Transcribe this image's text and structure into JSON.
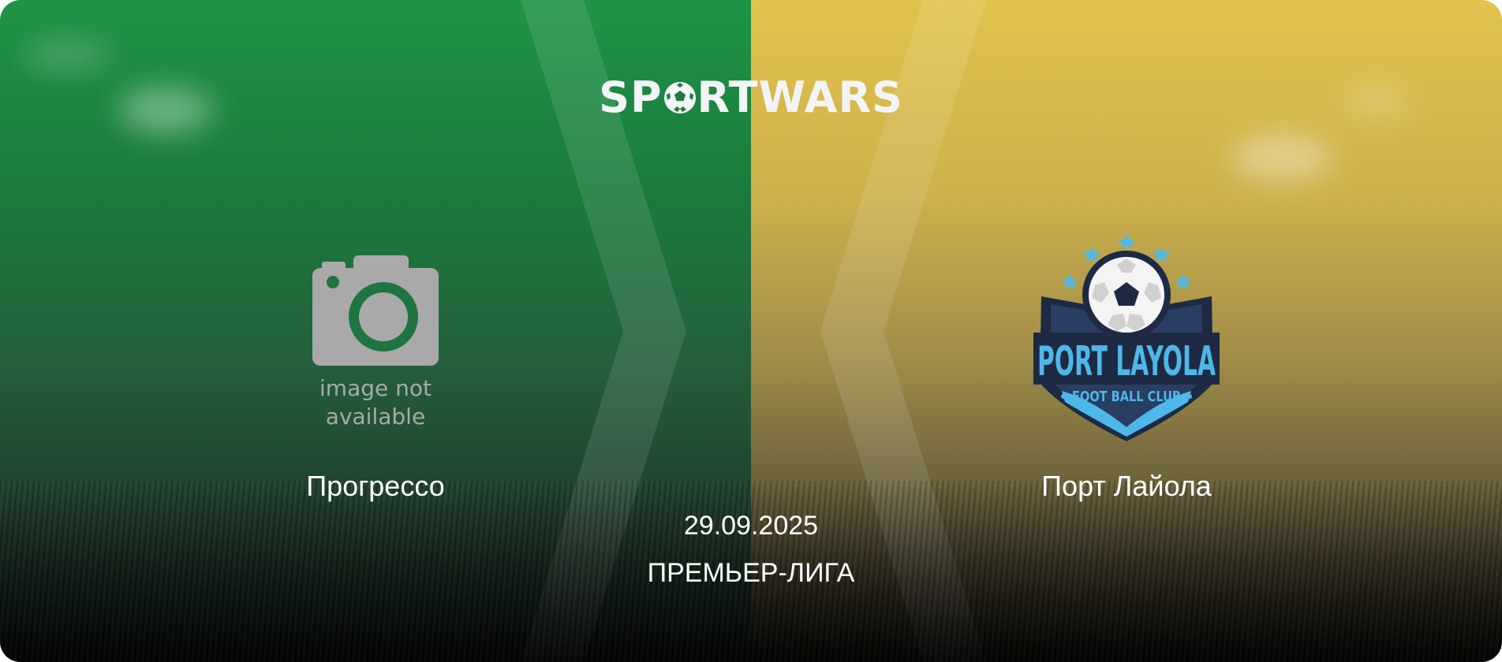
{
  "brand": {
    "logo_part1": "SP",
    "logo_part2": "RTWARS",
    "logo_full": "SPORTWARS"
  },
  "match": {
    "home_team": "Прогрессо",
    "away_team": "Порт Лайола",
    "date": "29.09.2025",
    "league": "ПРЕМЬЕР-ЛИГА"
  },
  "home_crest": {
    "icon": "camera-placeholder-icon",
    "line1": "image not",
    "line2": "available"
  },
  "away_crest": {
    "icon": "port-layola-crest",
    "title": "PORT LAYOLA",
    "subtitle": "FOOT BALL CLUB"
  },
  "colors": {
    "home_side": "#1f9447",
    "away_side": "#e2c24c",
    "crest_blue": "#4db8e8",
    "crest_navy": "#1e2a44"
  }
}
